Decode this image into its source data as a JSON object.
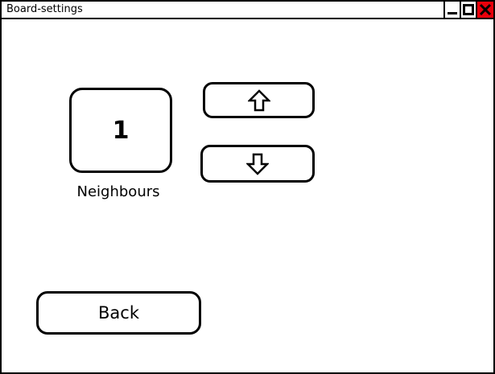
{
  "window": {
    "title": "Board-settings",
    "close_color": "#e8000b",
    "buttons": [
      "minimize-icon",
      "maximize-icon",
      "close-icon"
    ]
  },
  "counter": {
    "value": "1",
    "label": "Neighbours"
  },
  "controls": {
    "increment_icon": "arrow-up-icon",
    "decrement_icon": "arrow-down-icon"
  },
  "back_button": {
    "label": "Back"
  }
}
